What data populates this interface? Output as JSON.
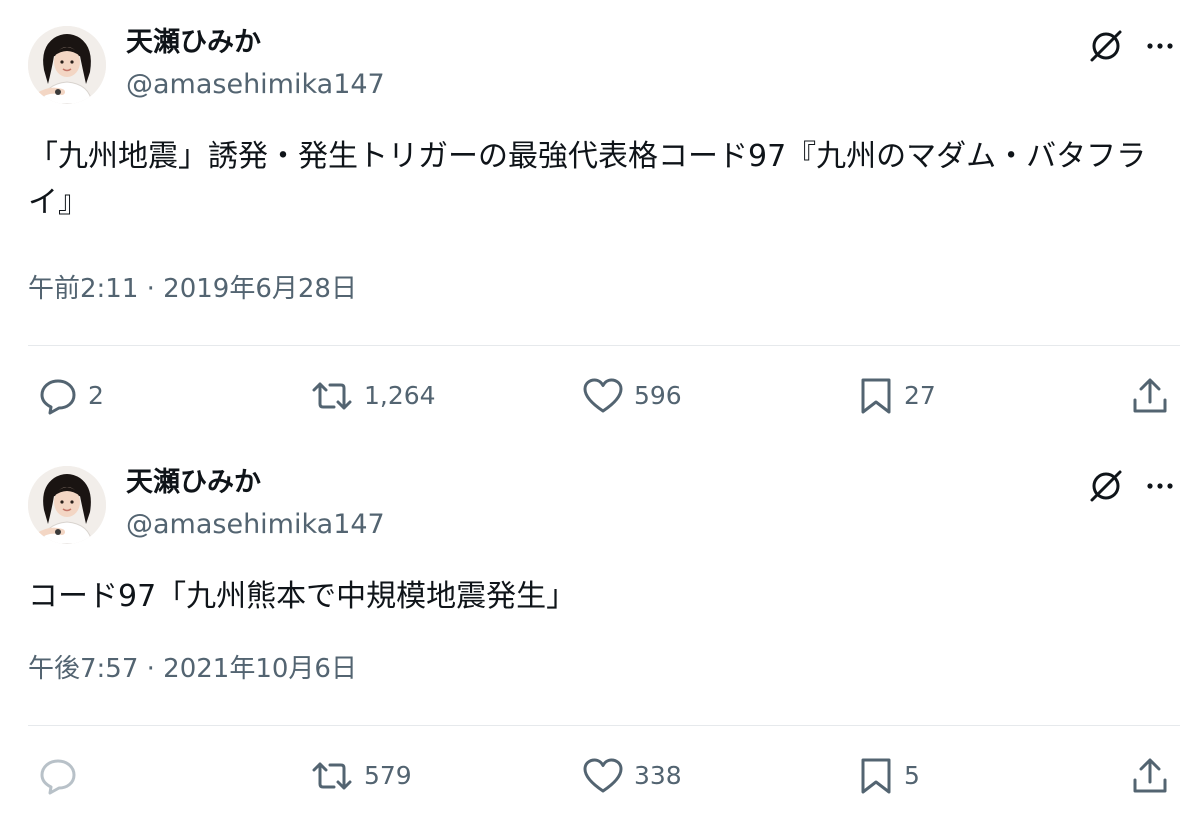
{
  "tweets": [
    {
      "author": {
        "display_name": "天瀬ひみか",
        "handle": "@amasehimika147",
        "avatar_icon": "profile-photo"
      },
      "text": "「九州地震」誘発・発生トリガーの最強代表格コード97『九州のマダム・バタフライ』",
      "timestamp": "午前2:11 · 2019年6月28日",
      "metrics": {
        "replies": "2",
        "retweets": "1,264",
        "likes": "596",
        "bookmarks": "27"
      }
    },
    {
      "author": {
        "display_name": "天瀬ひみか",
        "handle": "@amasehimika147",
        "avatar_icon": "profile-photo"
      },
      "text": "コード97「九州熊本で中規模地震発生」",
      "timestamp": "午後7:57 · 2021年10月6日",
      "metrics": {
        "replies": "",
        "retweets": "579",
        "likes": "338",
        "bookmarks": "5"
      }
    }
  ],
  "icons": {
    "grok": "grok-slash-circle-icon",
    "more": "more-dots-icon",
    "reply": "reply-bubble-icon",
    "retweet": "retweet-arrows-icon",
    "like": "heart-icon",
    "bookmark": "bookmark-icon",
    "share": "share-upload-icon"
  },
  "colors": {
    "text": "#0f1419",
    "secondary": "#536471",
    "divider": "#e6e9ec",
    "disabled": "#b8c1c8"
  }
}
